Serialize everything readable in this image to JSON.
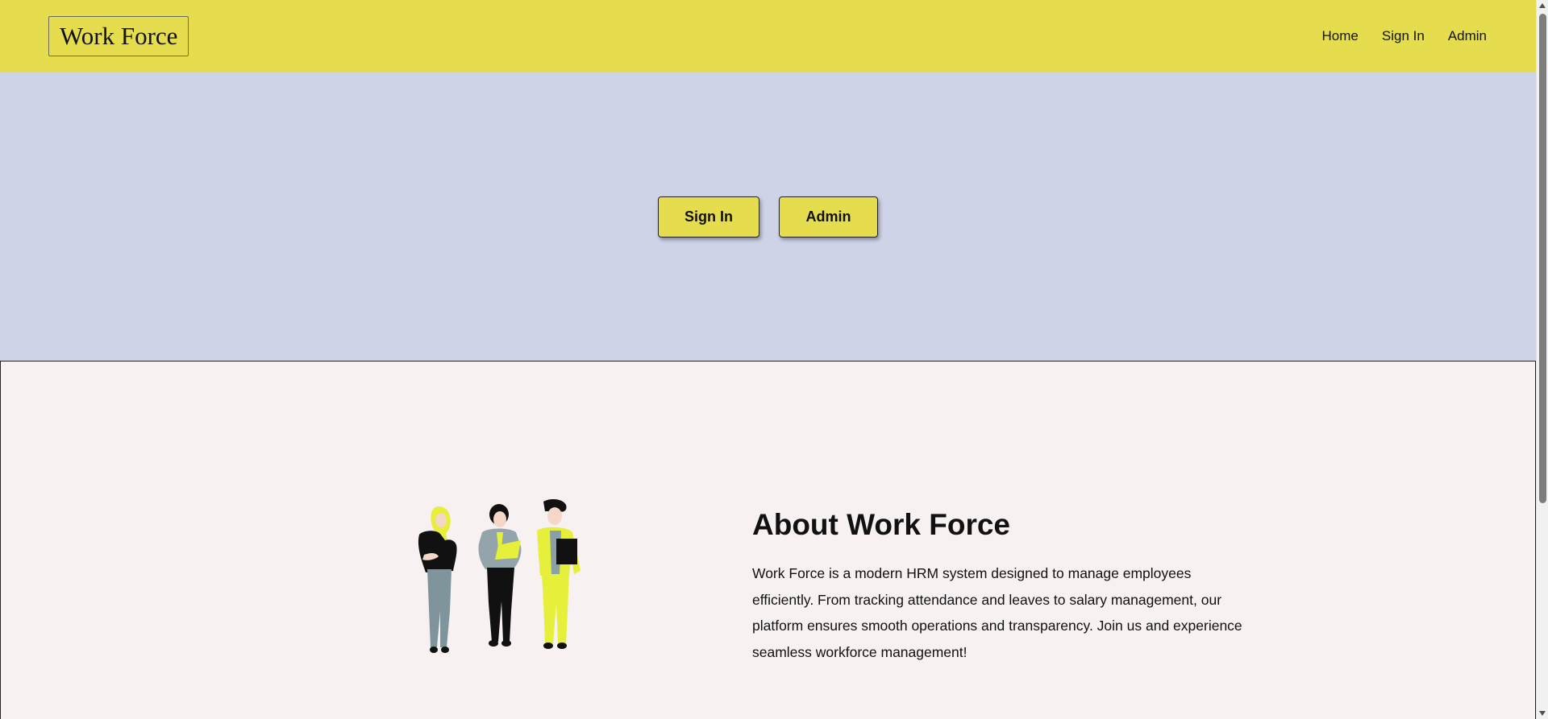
{
  "header": {
    "brand": "Work Force",
    "nav": [
      {
        "label": "Home"
      },
      {
        "label": "Sign In"
      },
      {
        "label": "Admin"
      }
    ]
  },
  "hero": {
    "signin_label": "Sign In",
    "admin_label": "Admin"
  },
  "about": {
    "title": "About Work Force",
    "text": "Work Force is a modern HRM system designed to manage employees efficiently. From tracking attendance and leaves to salary management, our platform ensures smooth operations and transparency. Join us and experience seamless workforce management!"
  },
  "colors": {
    "header_bg": "#e6dd4e",
    "hero_bg": "#ced3e8",
    "page_bg": "#f7f1f1",
    "accent_yellow": "#e6dd4e"
  },
  "icons": {
    "illustration": "team-of-three-people-illustration"
  }
}
